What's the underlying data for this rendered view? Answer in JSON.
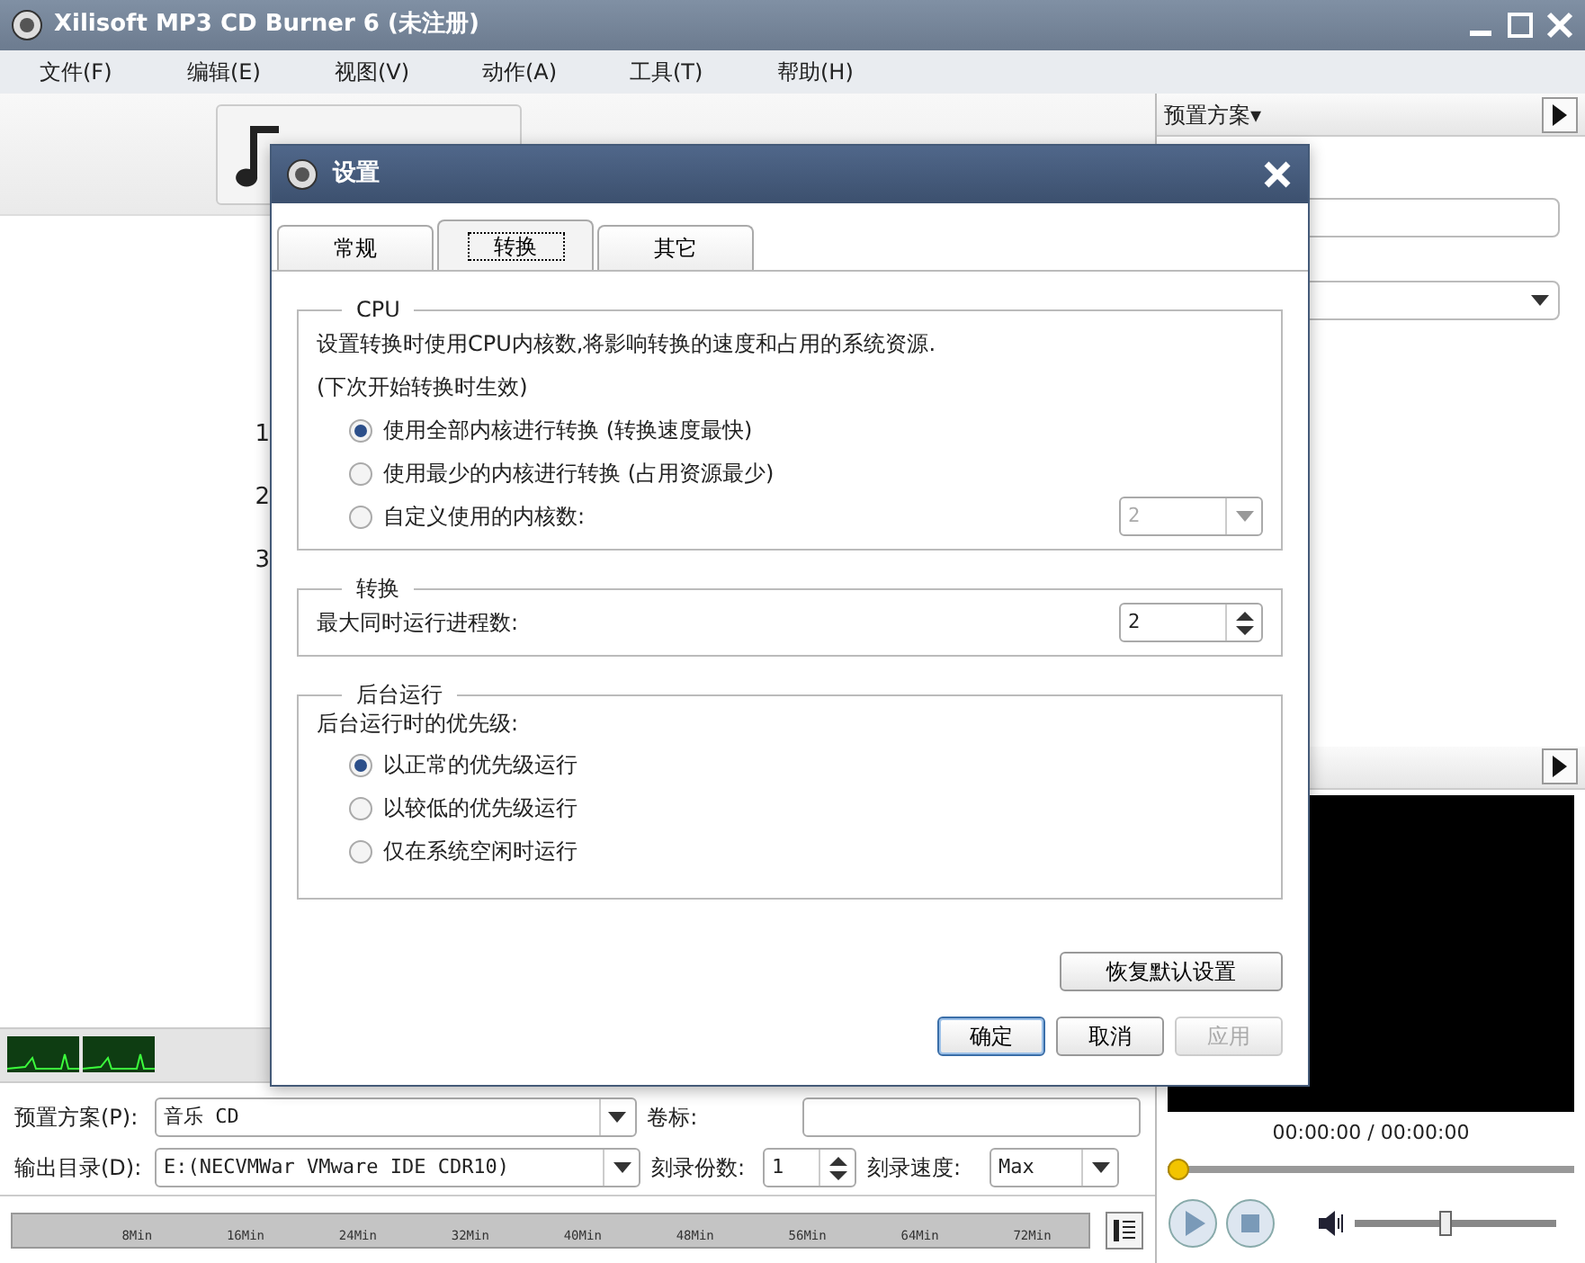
{
  "window": {
    "title": "Xilisoft MP3 CD Burner 6 (未注册)"
  },
  "menu": [
    "文件(F)",
    "编辑(E)",
    "视图(V)",
    "动作(A)",
    "工具(T)",
    "帮助(H)"
  ],
  "track_numbers": [
    "1",
    "2",
    "3"
  ],
  "right_panel": {
    "header": "预置方案▾"
  },
  "bottom_form": {
    "preset_label": "预置方案(P):",
    "preset_value": "音乐 CD",
    "volume_label": "卷标:",
    "output_label": "输出目录(D):",
    "output_value": "E:(NECVMWar VMware IDE CDR10)",
    "copies_label": "刻录份数:",
    "copies_value": "1",
    "speed_label": "刻录速度:",
    "speed_value": "Max"
  },
  "timeline": {
    "ticks": [
      "8Min",
      "16Min",
      "24Min",
      "32Min",
      "40Min",
      "48Min",
      "56Min",
      "64Min",
      "72Min"
    ]
  },
  "player": {
    "time": "00:00:00 / 00:00:00",
    "progress": {
      "level": 0
    },
    "volume": {
      "level": 0.45
    }
  },
  "dialog": {
    "title": "设置",
    "tabs": [
      {
        "label": "常规",
        "selected": false
      },
      {
        "label": "转换",
        "selected": true
      },
      {
        "label": "其它",
        "selected": false
      }
    ],
    "cpu": {
      "legend": "CPU",
      "description": "设置转换时使用CPU内核数,将影响转换的速度和占用的系统资源.",
      "note": "(下次开始转换时生效)",
      "options": [
        {
          "label": "使用全部内核进行转换 (转换速度最快)",
          "selected": true
        },
        {
          "label": "使用最少的内核进行转换 (占用资源最少)",
          "selected": false
        },
        {
          "label": "自定义使用的内核数:",
          "selected": false
        }
      ],
      "core_select": {
        "value": "2",
        "disabled": true
      }
    },
    "convert": {
      "legend": "转换",
      "label": "最大同时运行进程数:",
      "value": "2"
    },
    "background": {
      "legend": "后台运行",
      "label": "后台运行时的优先级:",
      "options": [
        {
          "label": "以正常的优先级运行",
          "selected": true
        },
        {
          "label": "以较低的优先级运行",
          "selected": false
        },
        {
          "label": "仅在系统空闲时运行",
          "selected": false
        }
      ]
    },
    "restore_button": "恢复默认设置",
    "buttons": [
      {
        "label": "确定",
        "kind": "default",
        "disabled": false
      },
      {
        "label": "取消",
        "kind": "normal",
        "disabled": false
      },
      {
        "label": "应用",
        "kind": "normal",
        "disabled": true
      }
    ]
  }
}
